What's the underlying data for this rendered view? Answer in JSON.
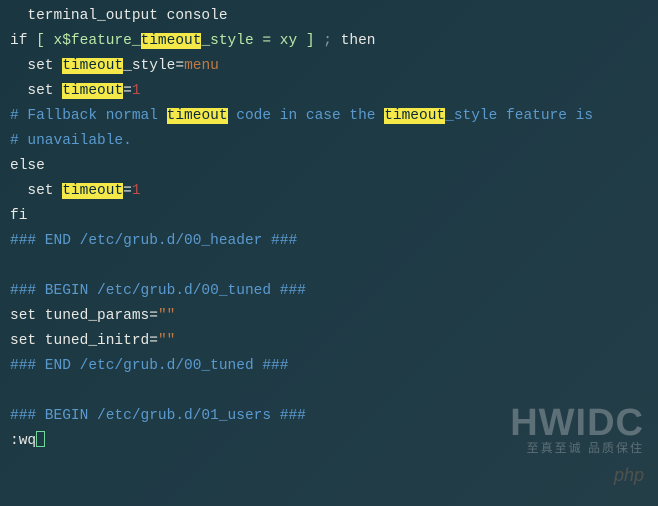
{
  "lines": {
    "l0": {
      "a": "  terminal_output console"
    },
    "l1": {
      "a": "if",
      "b": " [ x$feature_",
      "c": "timeout",
      "d": "_style = xy ]",
      "e": " ; ",
      "f": "then"
    },
    "l2": {
      "a": "  set ",
      "b": "timeout",
      "c": "_style=",
      "d": "menu"
    },
    "l3": {
      "a": "  set ",
      "b": "timeout",
      "c": "=",
      "d": "1"
    },
    "l4": {
      "a": "# Fallback normal ",
      "b": "timeout",
      "c": " code in case the ",
      "d": "timeout",
      "e": "_style feature is"
    },
    "l5": {
      "a": "# unavailable."
    },
    "l6": {
      "a": "else"
    },
    "l7": {
      "a": "  set ",
      "b": "timeout",
      "c": "=",
      "d": "1"
    },
    "l8": {
      "a": "fi"
    },
    "l9": {
      "a": "### END /etc/grub.d/00_header ###"
    },
    "l10": {
      "a": ""
    },
    "l11": {
      "a": "### BEGIN /etc/grub.d/00_tuned ###"
    },
    "l12": {
      "a": "set",
      "b": " tuned_params=",
      "c": "\"\""
    },
    "l13": {
      "a": "set",
      "b": " tuned_initrd=",
      "c": "\"\""
    },
    "l14": {
      "a": "### END /etc/grub.d/00_tuned ###"
    },
    "l15": {
      "a": ""
    },
    "l16": {
      "a": "### BEGIN /etc/grub.d/01_users ###"
    },
    "l17": {
      "a": ":wq"
    }
  },
  "watermark": {
    "big": "HWIDC",
    "small": "至真至诚 品质保住",
    "php": "php"
  }
}
